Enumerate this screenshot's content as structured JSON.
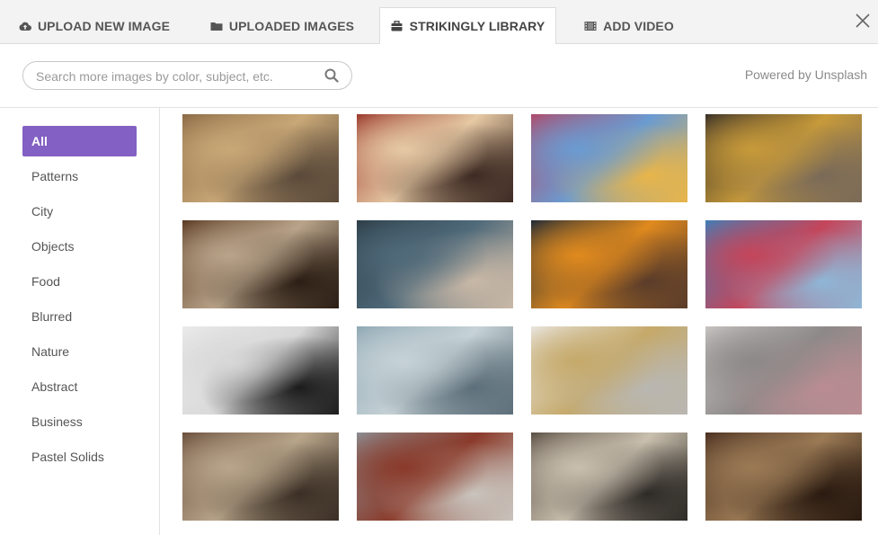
{
  "tabs": [
    {
      "label": "UPLOAD NEW IMAGE",
      "icon": "cloud-upload-icon"
    },
    {
      "label": "UPLOADED IMAGES",
      "icon": "folder-icon"
    },
    {
      "label": "STRIKINGLY LIBRARY",
      "icon": "briefcase-icon",
      "active": true
    },
    {
      "label": "ADD VIDEO",
      "icon": "film-icon"
    }
  ],
  "search": {
    "placeholder": "Search more images by color, subject, etc.",
    "value": ""
  },
  "powered_by": "Powered by Unsplash",
  "categories": [
    {
      "label": "All",
      "active": true
    },
    {
      "label": "Patterns"
    },
    {
      "label": "City"
    },
    {
      "label": "Objects"
    },
    {
      "label": "Food"
    },
    {
      "label": "Blurred"
    },
    {
      "label": "Nature"
    },
    {
      "label": "Abstract"
    },
    {
      "label": "Business"
    },
    {
      "label": "Pastel Solids"
    }
  ],
  "colors": {
    "accent": "#8360c3",
    "tabbar_bg": "#f3f3f3"
  },
  "images": [
    {
      "subject": "train-station-hall",
      "palette": [
        "#8a6a45",
        "#c9a877",
        "#5b4a3a"
      ]
    },
    {
      "subject": "miniature-village",
      "palette": [
        "#9b3a2d",
        "#e6c9a4",
        "#3d2a22"
      ]
    },
    {
      "subject": "street-mural",
      "palette": [
        "#b04a6a",
        "#6a9bd1",
        "#e8b54a"
      ]
    },
    {
      "subject": "subway-train",
      "palette": [
        "#3a3128",
        "#c79a3a",
        "#7a6a58"
      ]
    },
    {
      "subject": "cafe-street",
      "palette": [
        "#5a3a22",
        "#b9a48a",
        "#2c1e14"
      ]
    },
    {
      "subject": "hands-with-camera",
      "palette": [
        "#2d3e48",
        "#4f6a7a",
        "#c9b8a6"
      ]
    },
    {
      "subject": "rusty-gear",
      "palette": [
        "#1f2a36",
        "#e08a1e",
        "#5a3c2a"
      ]
    },
    {
      "subject": "crab-trap-buoys",
      "palette": [
        "#3f7fb8",
        "#c4455a",
        "#8fb6d6"
      ]
    },
    {
      "subject": "wall-lamp",
      "palette": [
        "#ebebeb",
        "#d8d8d8",
        "#1c1c1c"
      ]
    },
    {
      "subject": "map-in-hands",
      "palette": [
        "#8fa8b5",
        "#c6d2d6",
        "#5d6f7a"
      ]
    },
    {
      "subject": "alarm-clock",
      "palette": [
        "#e9e6e1",
        "#c5a96a",
        "#b9b7b2"
      ]
    },
    {
      "subject": "record-player",
      "palette": [
        "#c8c4c2",
        "#8d8988",
        "#b98c92"
      ]
    },
    {
      "subject": "cactus-pot",
      "palette": [
        "#6a4e3c",
        "#b8a58a",
        "#3b2f25"
      ]
    },
    {
      "subject": "padlocks-on-fence",
      "palette": [
        "#8c8f93",
        "#8a3a2a",
        "#c9c4bd"
      ]
    },
    {
      "subject": "drafting-tools",
      "palette": [
        "#5a4f44",
        "#c9bfae",
        "#2e2a26"
      ]
    },
    {
      "subject": "vintage-tools",
      "palette": [
        "#4a3020",
        "#9b7a55",
        "#2a1a10"
      ]
    }
  ]
}
